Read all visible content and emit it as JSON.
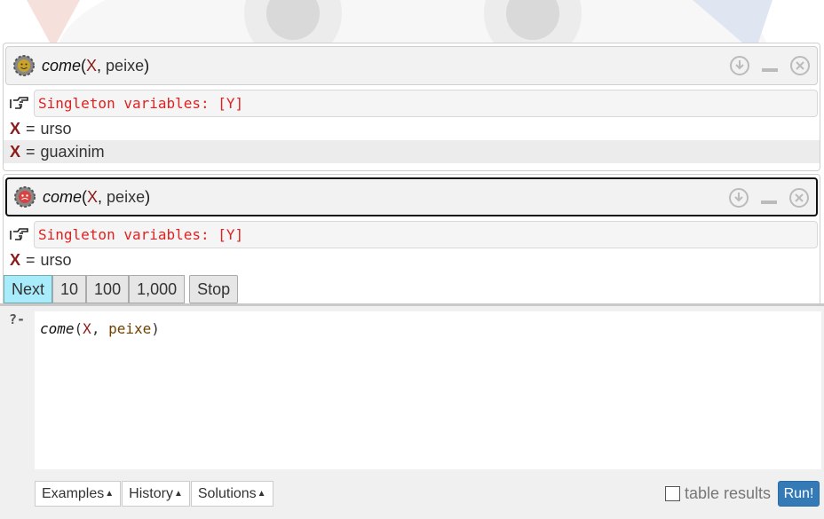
{
  "queries": [
    {
      "predicate": "come",
      "open_paren": "(",
      "var": "X",
      "sep": ", ",
      "atom": "peixe",
      "close_paren": ")",
      "warning": "Singleton variables: [Y]",
      "answers": [
        {
          "var": "X",
          "eq": "=",
          "value": "urso"
        },
        {
          "var": "X",
          "eq": "=",
          "value": "guaxinim"
        }
      ]
    },
    {
      "predicate": "come",
      "open_paren": "(",
      "var": "X",
      "sep": ", ",
      "atom": "peixe",
      "close_paren": ")",
      "warning": "Singleton variables: [Y]",
      "answers": [
        {
          "var": "X",
          "eq": "=",
          "value": "urso"
        }
      ],
      "controls": {
        "next": "Next",
        "ten": "10",
        "hundred": "100",
        "thousand": "1,000",
        "stop": "Stop"
      }
    }
  ],
  "editor": {
    "prompt": "?-",
    "predicate": "come",
    "open_paren": "(",
    "var": "X",
    "sep": ", ",
    "atom": "peixe",
    "close_paren": ")"
  },
  "bottom": {
    "examples": "Examples",
    "history": "History",
    "solutions": "Solutions",
    "caret": "▲",
    "table_results": "table results",
    "run": "Run!"
  },
  "icons": {
    "gear": "gear-icon",
    "download": "download-icon",
    "minimize": "minimize-icon",
    "close": "close-icon",
    "hand": "pointing-hand-icon"
  },
  "colors": {
    "accent": "#337ab7",
    "next_bg": "#a8ecfb",
    "warning": "#e0211f",
    "variable": "#8b1a1a"
  }
}
